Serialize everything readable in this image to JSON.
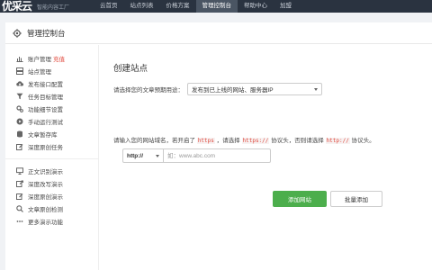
{
  "brand": {
    "logo": "优采云",
    "tagline": "智能内容工厂"
  },
  "nav": [
    "云首页",
    "站点列表",
    "价格方案",
    "管理控制台",
    "帮助中心",
    "加盟"
  ],
  "nav_active_index": 3,
  "panel": {
    "title": "管理控制台"
  },
  "sidebar": {
    "group1": [
      {
        "label": "账户管理",
        "badge": "充值",
        "icon": "bar-chart-icon"
      },
      {
        "label": "站点管理",
        "icon": "server-icon"
      },
      {
        "label": "发布接口配置",
        "icon": "cloud-upload-icon"
      },
      {
        "label": "任务目标管理",
        "icon": "filter-icon"
      },
      {
        "label": "功能细节设置",
        "icon": "gears-icon"
      },
      {
        "label": "手动运行测试",
        "icon": "play-circle-icon"
      },
      {
        "label": "文章暂存库",
        "icon": "database-icon"
      },
      {
        "label": "深度原创任务",
        "icon": "edit-icon"
      }
    ],
    "group2": [
      {
        "label": "正文识别演示",
        "icon": "desktop-icon"
      },
      {
        "label": "深度改写演示",
        "icon": "share-icon"
      },
      {
        "label": "深度原创演示",
        "icon": "edit-icon"
      },
      {
        "label": "文章原创检测",
        "icon": "search-icon"
      },
      {
        "label": "更多演示功能",
        "icon": "more-icon"
      }
    ]
  },
  "form": {
    "section_title": "创建站点",
    "usage_label": "请选择您的文章预期用途：",
    "usage_selected": "发布到已上线的网站、服务器IP",
    "hint_part1": "请输入您的网站域名，若开启了 ",
    "hint_code1": "https",
    "hint_part2": " ，请选择 ",
    "hint_code2": "https://",
    "hint_part3": " 协议头，否则请选择 ",
    "hint_code3": "http://",
    "hint_part4": " 协议头。",
    "protocol": "http://",
    "domain_value": "",
    "domain_placeholder": "如：www.abc.com",
    "add_button": "添加网站",
    "batch_button": "批量添加"
  },
  "colors": {
    "topbar": "#2a3340",
    "primary": "#4cae4c",
    "accent_red": "#e0483c"
  }
}
